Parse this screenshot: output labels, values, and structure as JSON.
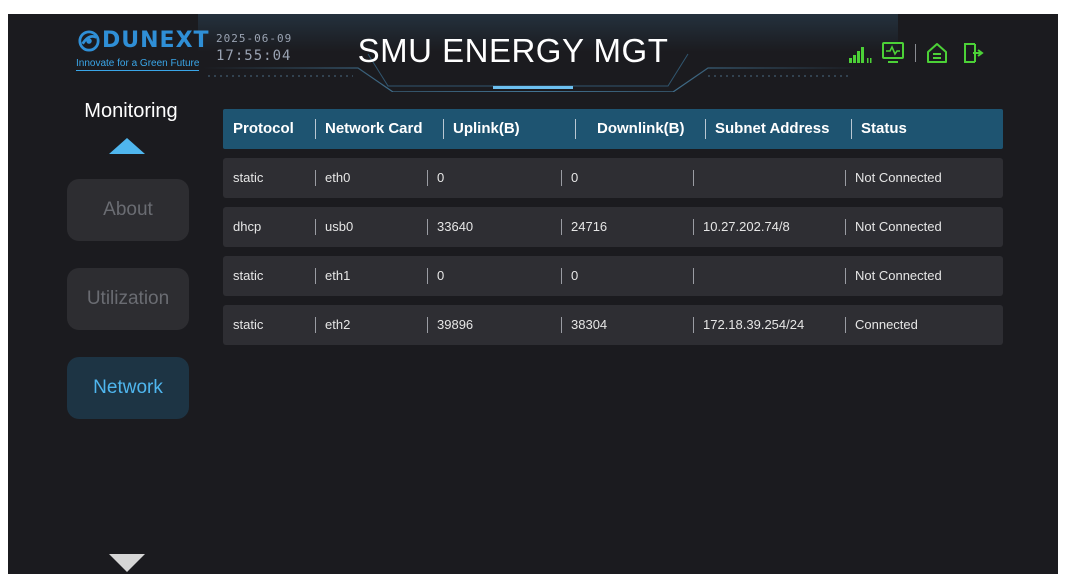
{
  "header": {
    "logo_text": "DUNEXT",
    "tagline": "Innovate for a Green Future",
    "date": "2025-06-09",
    "time": "17:55:04",
    "title": "SMU ENERGY MGT",
    "icons": [
      "signal-bars-icon",
      "monitor-icon",
      "home-icon",
      "logout-icon"
    ]
  },
  "sidebar": {
    "section_label": "Monitoring",
    "items": [
      {
        "label": "About",
        "active": false
      },
      {
        "label": "Utilization",
        "active": false
      },
      {
        "label": "Network",
        "active": true
      }
    ]
  },
  "table": {
    "columns": [
      "Protocol",
      "Network Card",
      "Uplink(B)",
      "Downlink(B)",
      "Subnet Address",
      "Status"
    ],
    "rows": [
      [
        "static",
        "eth0",
        "0",
        "0",
        "",
        "Not Connected"
      ],
      [
        "dhcp",
        "usb0",
        "33640",
        "24716",
        "10.27.202.74/8",
        "Not Connected"
      ],
      [
        "static",
        "eth1",
        "0",
        "0",
        "",
        "Not Connected"
      ],
      [
        "static",
        "eth2",
        "39896",
        "38304",
        "172.18.39.254/24",
        "Connected"
      ]
    ]
  },
  "colors": {
    "accent": "#4fb6ee",
    "header_row": "#1e5471",
    "row_bg": "#2e2e33",
    "panel_bg": "#1b1b1f",
    "signal": "#4cd137"
  }
}
